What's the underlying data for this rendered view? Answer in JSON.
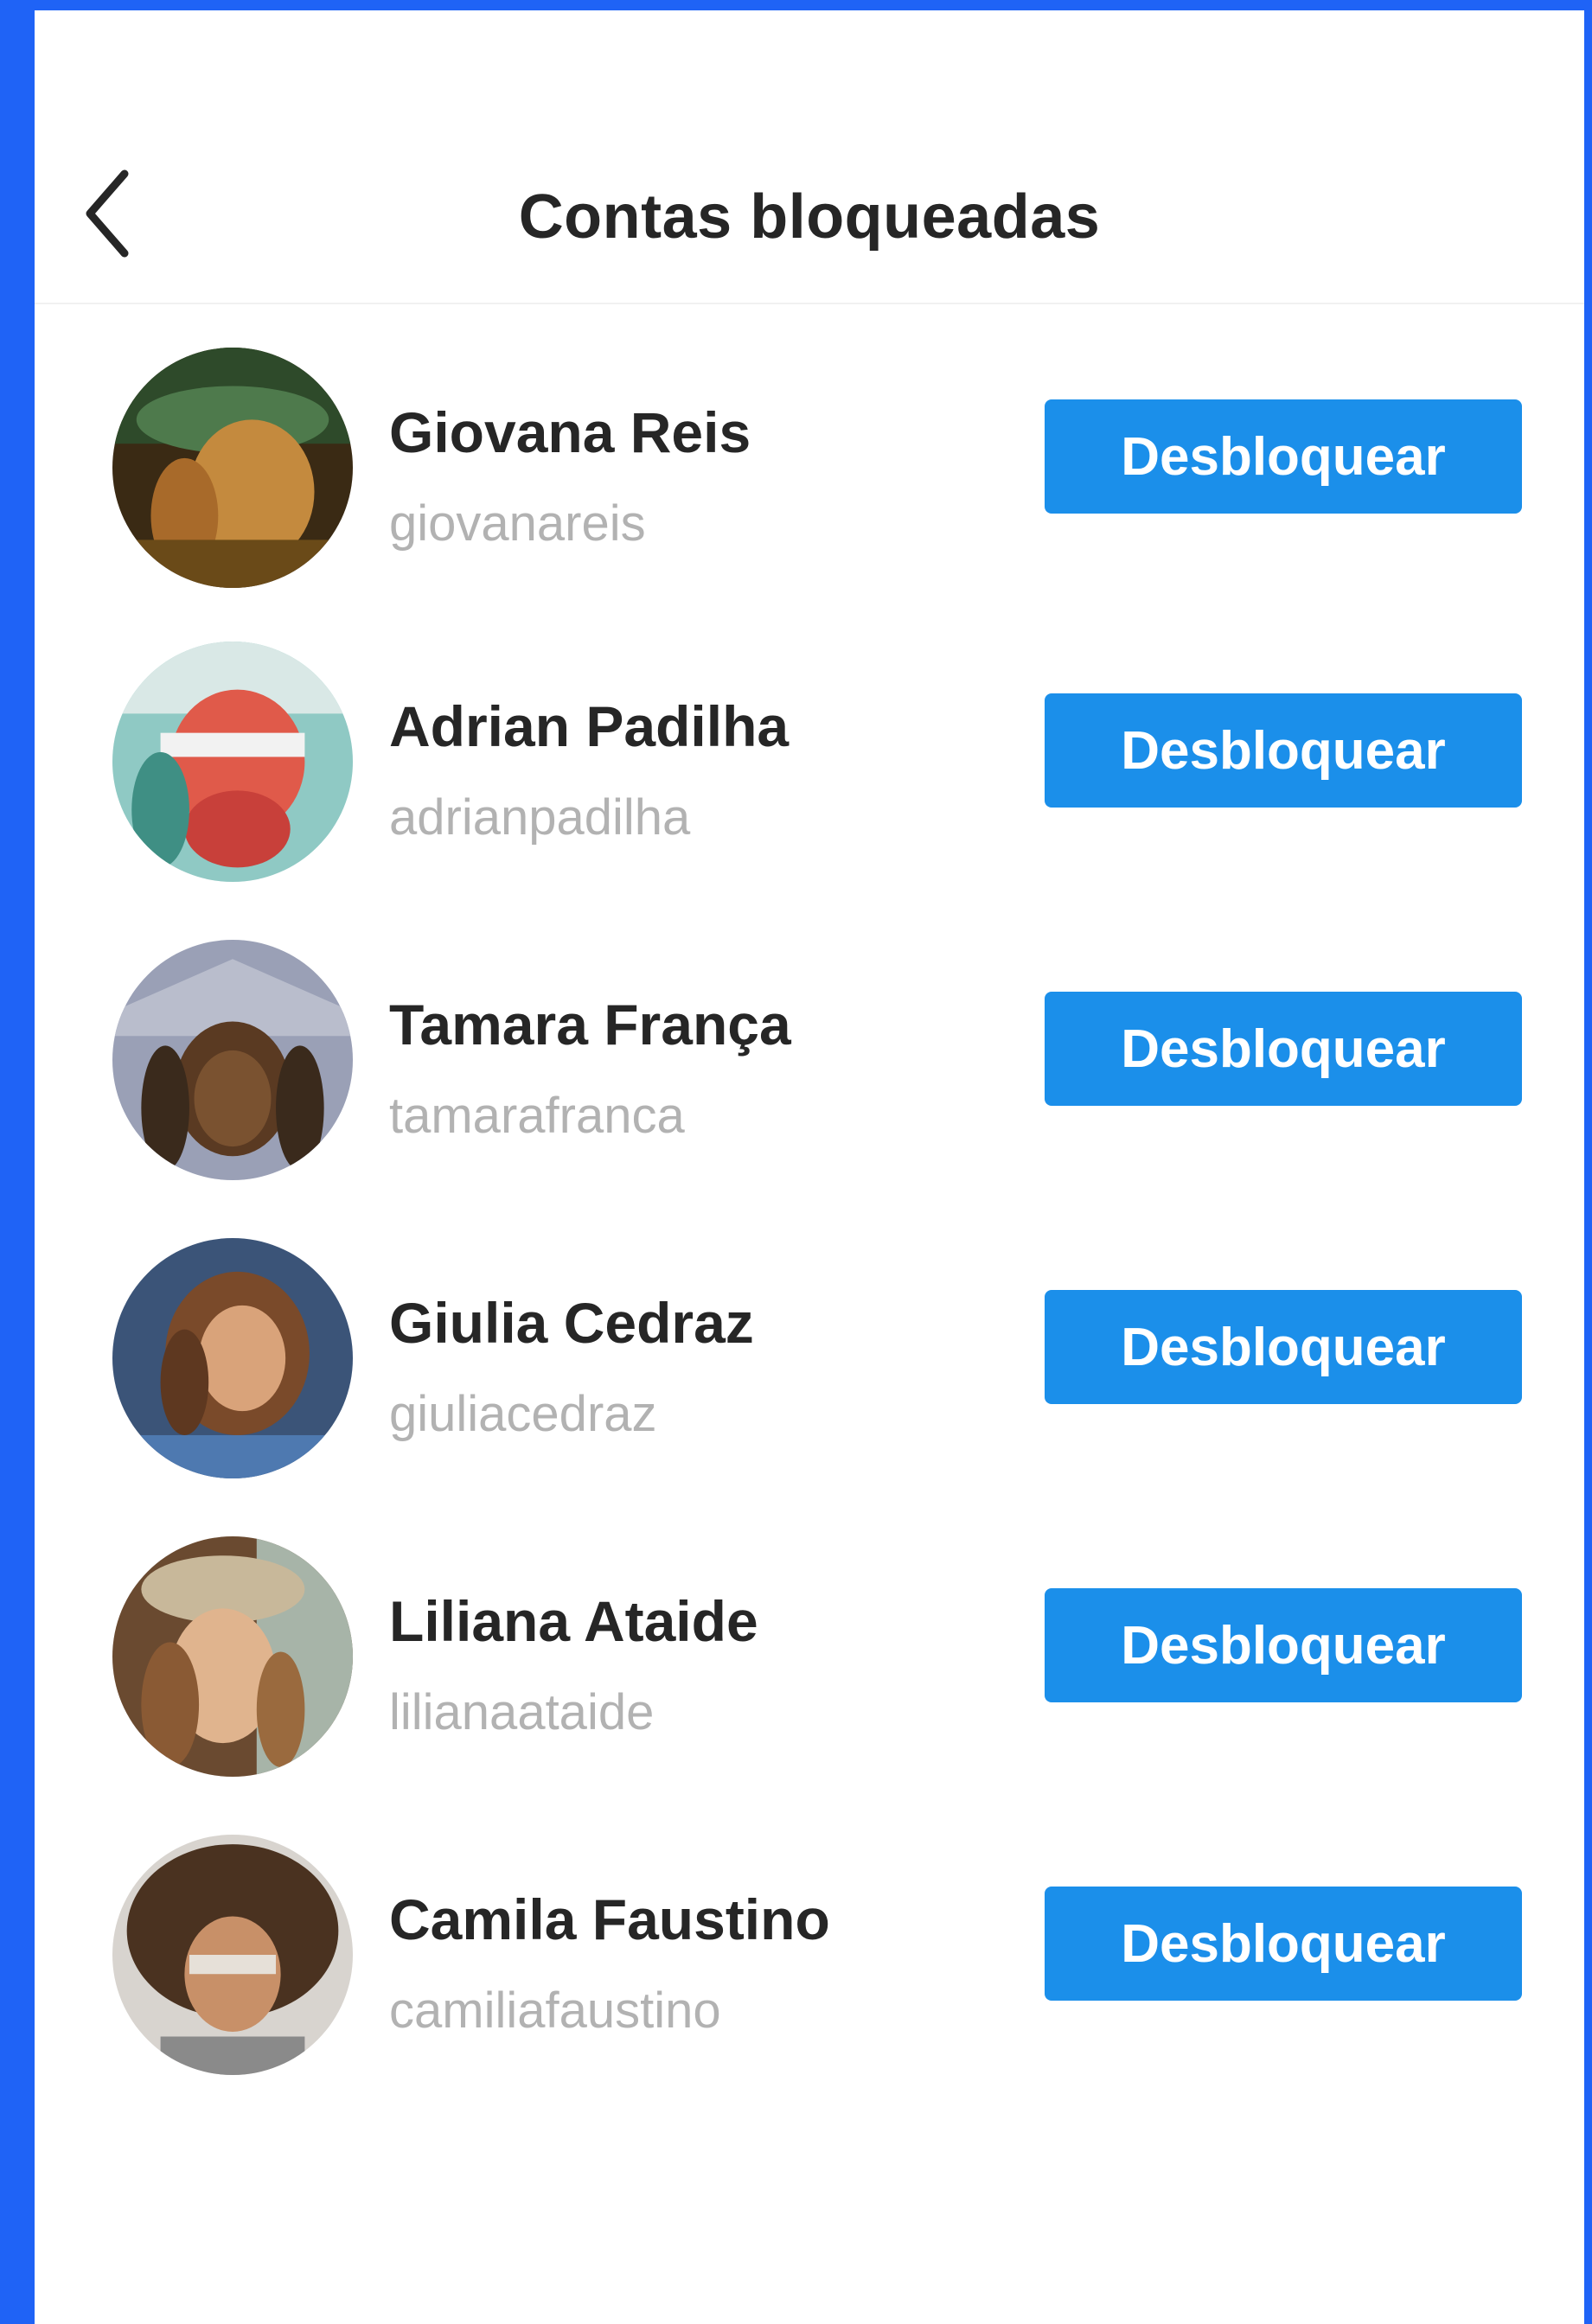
{
  "header": {
    "title": "Contas bloqueadas",
    "back_icon": "chevron-left-icon"
  },
  "accounts": [
    {
      "name": "Giovana Reis",
      "username": "giovanareis",
      "button_label": "Desbloquear"
    },
    {
      "name": "Adrian Padilha",
      "username": "adrianpadilha",
      "button_label": "Desbloquear"
    },
    {
      "name": "Tamara França",
      "username": "tamarafranca",
      "button_label": "Desbloquear"
    },
    {
      "name": "Giulia Cedraz",
      "username": "giuliacedraz",
      "button_label": "Desbloquear"
    },
    {
      "name": "Liliana Ataide",
      "username": "lilianaataide",
      "button_label": "Desbloquear"
    },
    {
      "name": "Camila Faustino",
      "username": "camiliafaustino",
      "button_label": "Desbloquear"
    }
  ],
  "colors": {
    "frame_border": "#1f63f6",
    "button_bg": "#1b8fea",
    "button_text": "#ffffff",
    "name_text": "#262626",
    "username_text": "#b2b2b2"
  }
}
